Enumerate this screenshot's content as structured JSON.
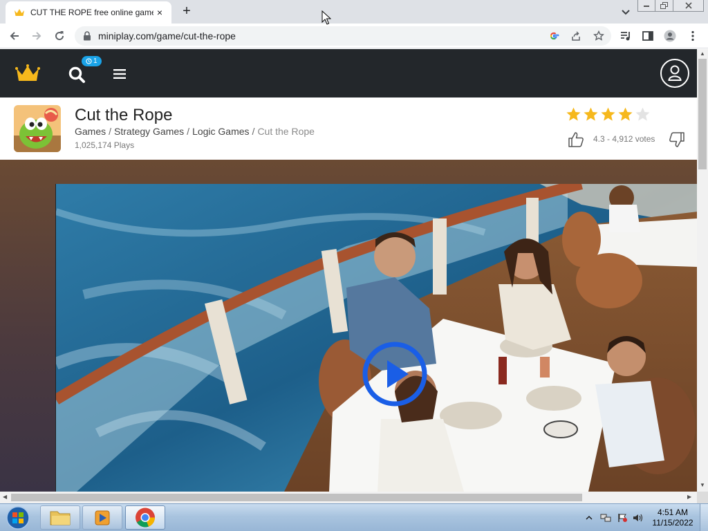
{
  "browser": {
    "tab_title": "CUT THE ROPE free online game",
    "tab_close": "×",
    "new_tab": "+",
    "url": "miniplay.com/game/cut-the-rope"
  },
  "site": {
    "notification_count": "1",
    "game": {
      "title": "Cut the Rope",
      "breadcrumbs": [
        {
          "label": "Games"
        },
        {
          "label": "Strategy Games"
        },
        {
          "label": "Logic Games"
        }
      ],
      "breadcrumb_sep": "/",
      "current_crumb": "Cut the Rope",
      "plays": "1,025,174 Plays",
      "rating_text": "4.3 - 4,912 votes",
      "rating_value": 4.3,
      "rating_max": 5
    }
  },
  "colors": {
    "site_header": "#23272b",
    "accent_blue": "#1a5ee6",
    "star_gold": "#f6b81c",
    "badge_blue": "#1aa3e8"
  },
  "taskbar": {
    "time": "4:51 AM",
    "date": "11/15/2022"
  }
}
